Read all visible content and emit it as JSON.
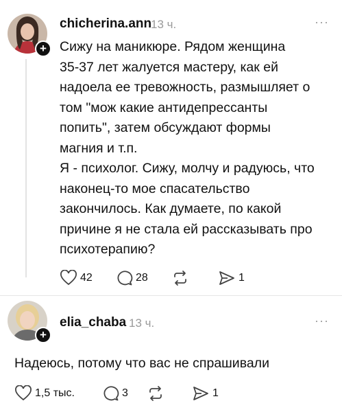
{
  "posts": [
    {
      "username": "chicherina.ann",
      "time": "13 ч.",
      "more": "···",
      "text": "Сижу на маникюре. Рядом женщина\n35-37 лет жалуется мастеру, как ей\nнадоела ее тревожность, размышляет о\nтом \"мож какие антидепрессанты\nпопить\", затем обсуждают формы\nмагния и т.п.\nЯ - психолог. Сижу, молчу и радуюсь, что\nнаконец-то мое спасательство\nзакончилось. Как думаете, по какой\nпричине я не стала ей рассказывать про\nпсихотерапию?",
      "likes": "42",
      "replies": "28",
      "shares": "1"
    },
    {
      "username": "elia_chaba",
      "time": "13 ч.",
      "more": "···",
      "text": "Надеюсь, потому что вас не спрашивали",
      "likes": "1,5 тыс.",
      "replies": "3",
      "shares": "1"
    }
  ],
  "icons": {
    "plus": "+",
    "like": "heart-icon",
    "reply": "comment-icon",
    "repost": "repost-icon",
    "share": "send-icon"
  }
}
